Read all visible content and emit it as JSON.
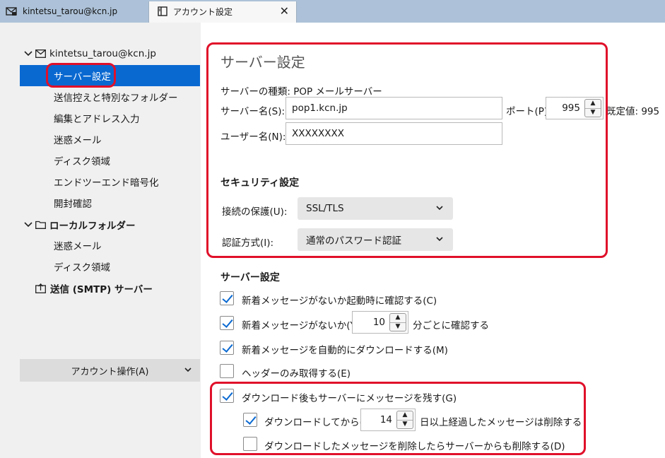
{
  "tabs": {
    "mail_tab": "kintetsu_tarou@kcn.jp",
    "settings_tab": "アカウント設定",
    "close": "✕"
  },
  "sidebar": {
    "account": "kintetsu_tarou@kcn.jp",
    "items": [
      "サーバー設定",
      "送信控えと特別なフォルダー",
      "編集とアドレス入力",
      "迷惑メール",
      "ディスク領域",
      "エンドツーエンド暗号化",
      "開封確認"
    ],
    "local_folder": "ローカルフォルダー",
    "local_items": [
      "迷惑メール",
      "ディスク領域"
    ],
    "smtp": "送信 (SMTP) サーバー",
    "account_ops": "アカウント操作(A)"
  },
  "server": {
    "heading": "サーバー設定",
    "type_label": "サーバーの種類: POP メールサーバー",
    "name_label": "サーバー名(S):",
    "name_value": "pop1.kcn.jp",
    "port_label": "ポート(P):",
    "port_value": "995",
    "default_label": "既定値: 995",
    "user_label": "ユーザー名(N):",
    "user_value": "XXXXXXXX"
  },
  "security": {
    "heading": "セキュリティ設定",
    "conn_label": "接続の保護(U):",
    "conn_value": "SSL/TLS",
    "auth_label": "認証方式(I):",
    "auth_value": "通常のパスワード認証"
  },
  "server_opts": {
    "heading": "サーバー設定",
    "opt1": "新着メッセージがないか起動時に確認する(C)",
    "opt2": "新着メッセージがないか(Y)",
    "opt2_value": "10",
    "opt2_suffix": "分ごとに確認する",
    "opt3": "新着メッセージを自動的にダウンロードする(M)",
    "opt4": "ヘッダーのみ取得する(E)",
    "opt5": "ダウンロード後もサーバーにメッセージを残す(G)",
    "opt6": "ダウンロードしてから(O)",
    "opt6_value": "14",
    "opt6_suffix": "日以上経過したメッセージは削除する",
    "opt7": "ダウンロードしたメッセージを削除したらサーバーからも削除する(D)"
  },
  "colors": {
    "accent": "#0a69d1",
    "highlight": "#e0102a",
    "tabbar": "#adc2d8",
    "sidebar": "#f0f0f0"
  },
  "checks": {
    "opt1": true,
    "opt2": true,
    "opt3": true,
    "opt4": false,
    "opt5": true,
    "opt6": true,
    "opt7": false
  }
}
